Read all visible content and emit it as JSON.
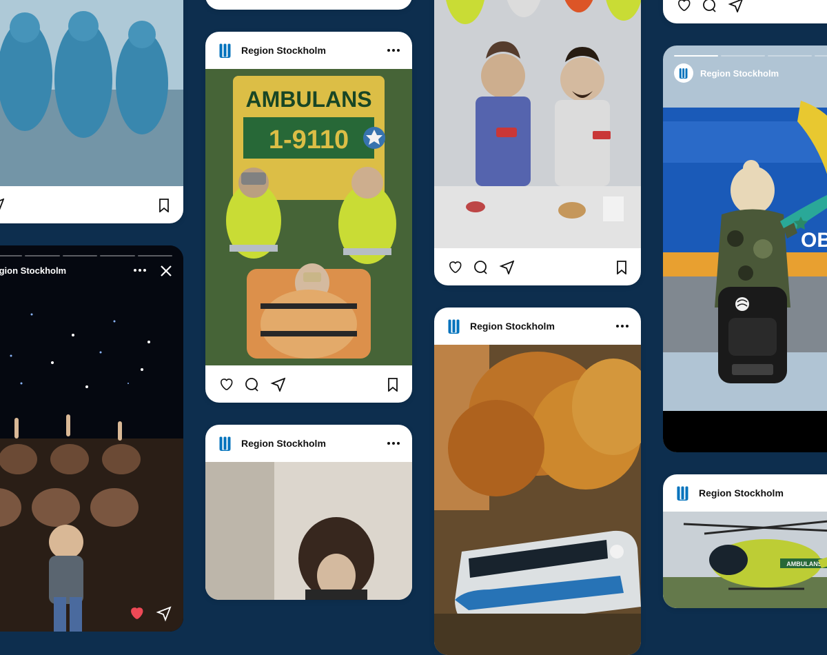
{
  "brand": {
    "name": "Region Stockholm",
    "logo_color": "#0072bc"
  },
  "cards": {
    "ambulance": {
      "text_top": "AMBULANS",
      "text_mid": "1-9110"
    },
    "train_side": {
      "text": "OBANAN"
    },
    "helicopter": {
      "text": "AMBULANS"
    }
  },
  "icons": {
    "heart": "heart-icon",
    "comment": "comment-icon",
    "share": "share-icon",
    "bookmark": "bookmark-icon",
    "more": "more-icon",
    "close": "close-icon"
  }
}
